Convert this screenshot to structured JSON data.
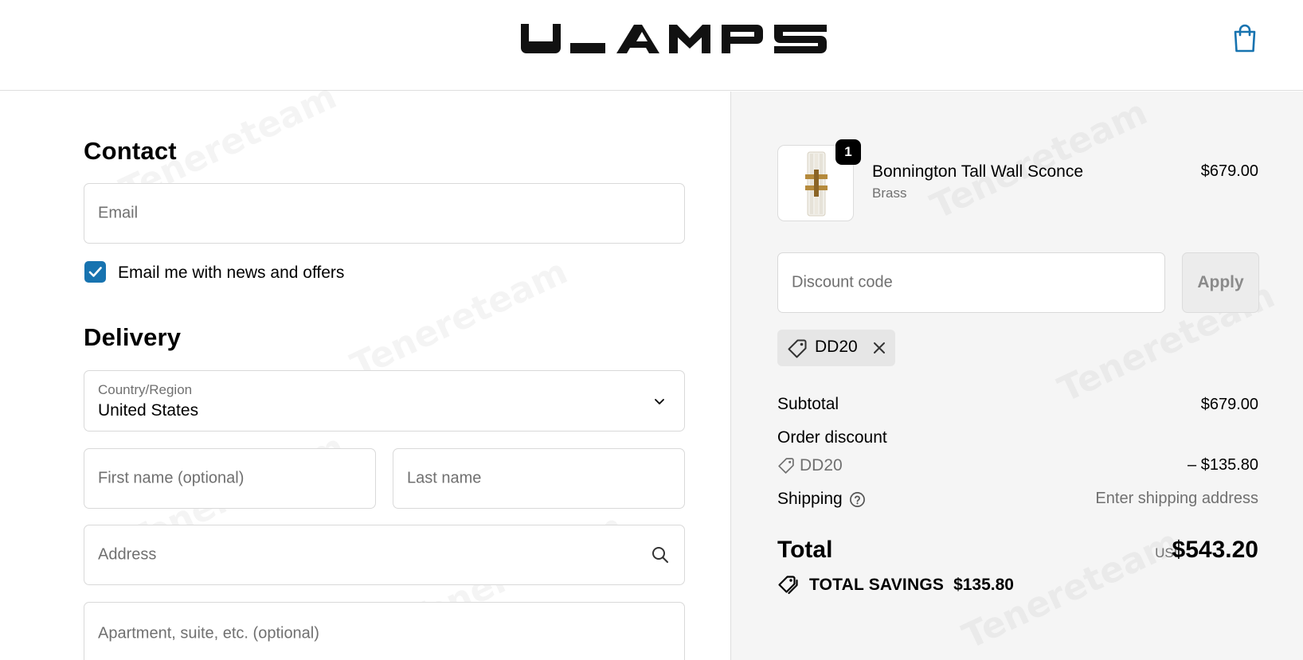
{
  "header": {
    "logo_text": "ULAMPS",
    "cart_icon": "shopping-bag-icon"
  },
  "contact": {
    "heading": "Contact",
    "email_placeholder": "Email",
    "newsletter_label": "Email me with news and offers",
    "newsletter_checked": true
  },
  "delivery": {
    "heading": "Delivery",
    "country_label": "Country/Region",
    "country_value": "United States",
    "first_name_placeholder": "First name (optional)",
    "last_name_placeholder": "Last name",
    "address_placeholder": "Address",
    "apartment_placeholder": "Apartment, suite, etc. (optional)"
  },
  "order": {
    "item": {
      "name": "Bonnington Tall Wall Sconce",
      "variant": "Brass",
      "price": "$679.00",
      "quantity": "1"
    },
    "discount_placeholder": "Discount code",
    "apply_label": "Apply",
    "applied_code": "DD20",
    "subtotal_label": "Subtotal",
    "subtotal_value": "$679.00",
    "order_discount_label": "Order discount",
    "discount_code": "DD20",
    "discount_value": "– $135.80",
    "shipping_label": "Shipping",
    "shipping_value": "Enter shipping address",
    "total_label": "Total",
    "total_currency": "USD",
    "total_value": "$543.20",
    "savings_label": "TOTAL SAVINGS",
    "savings_value": "$135.80"
  },
  "colors": {
    "accent": "#1773b0",
    "summary_bg": "#f5f5f5"
  },
  "watermark_text": "Tenereteam"
}
